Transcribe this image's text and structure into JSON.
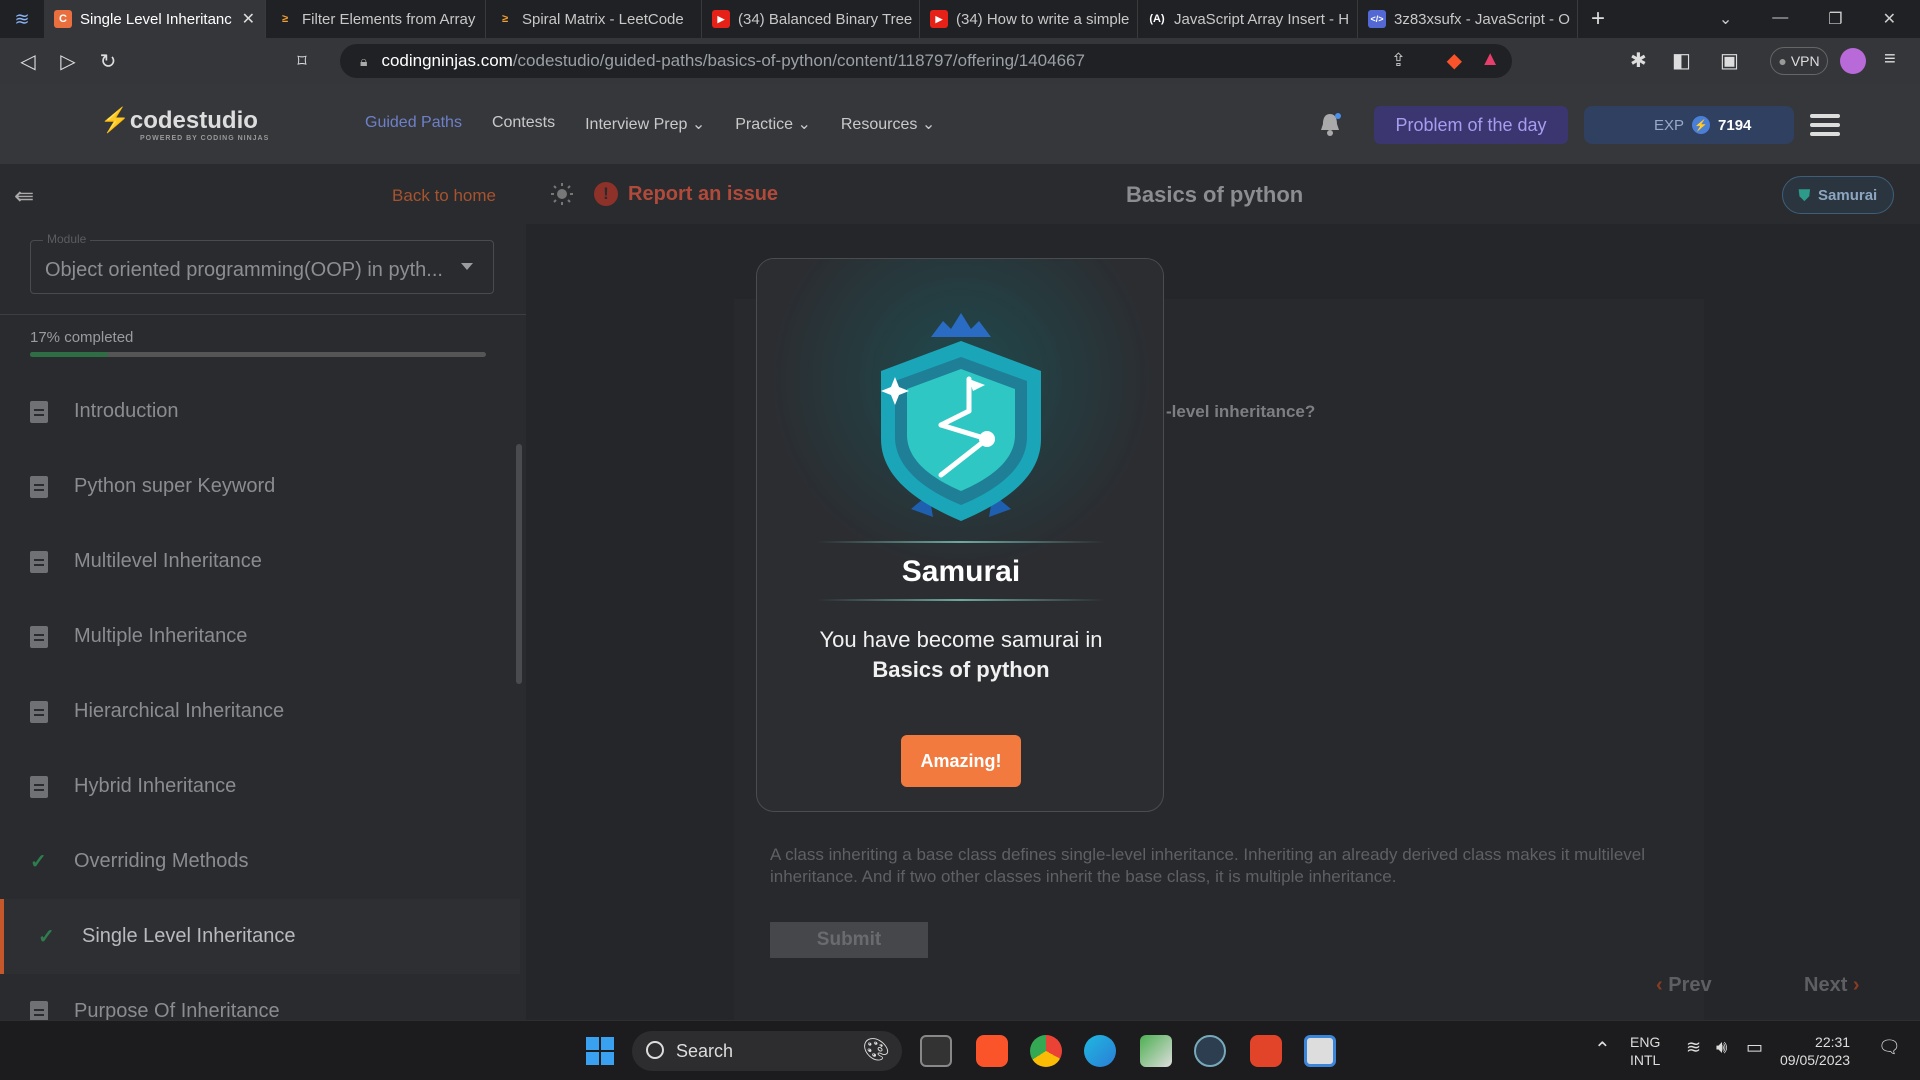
{
  "browser": {
    "tabs": [
      {
        "title": "Single Level Inheritanc",
        "active": true
      },
      {
        "title": "Filter Elements from Array",
        "active": false
      },
      {
        "title": "Spiral Matrix - LeetCode",
        "active": false
      },
      {
        "title": "(34) Balanced Binary Tree",
        "active": false
      },
      {
        "title": "(34) How to write a simple",
        "active": false
      },
      {
        "title": "JavaScript Array Insert - H",
        "active": false
      },
      {
        "title": "3z83xsufx - JavaScript - O",
        "active": false
      }
    ],
    "url_host": "codingninjas.com",
    "url_path": "/codestudio/guided-paths/basics-of-python/content/118797/offering/1404667",
    "vpn_label": "VPN"
  },
  "site": {
    "logo": "codestudio",
    "logo_sub": "POWERED BY CODING NINJAS",
    "nav": [
      {
        "label": "Guided Paths",
        "active": true
      },
      {
        "label": "Contests",
        "active": false
      },
      {
        "label": "Interview Prep",
        "active": false
      },
      {
        "label": "Practice",
        "active": false
      },
      {
        "label": "Resources",
        "active": false
      }
    ],
    "potd_label": "Problem of the day",
    "exp_label": "EXP",
    "exp_value": "7194"
  },
  "sidebar": {
    "back_label": "Back to home",
    "module_label": "Module",
    "module_value": "Object oriented programming(OOP) in pyth...",
    "progress_text": "17% completed",
    "progress_fraction": 0.17,
    "items": [
      {
        "label": "Introduction",
        "state": "doc"
      },
      {
        "label": "Python super Keyword",
        "state": "doc"
      },
      {
        "label": "Multilevel Inheritance",
        "state": "doc"
      },
      {
        "label": "Multiple Inheritance",
        "state": "doc"
      },
      {
        "label": "Hierarchical Inheritance",
        "state": "doc"
      },
      {
        "label": "Hybrid Inheritance",
        "state": "doc"
      },
      {
        "label": "Overriding Methods",
        "state": "done"
      },
      {
        "label": "Single Level Inheritance",
        "state": "active"
      },
      {
        "label": "Purpose Of Inheritance",
        "state": "doc"
      }
    ]
  },
  "main": {
    "report_label": "Report an issue",
    "page_title": "Basics of python",
    "rank_label": "Samurai",
    "question_fragment": "-level inheritance?",
    "explanation": "A class inheriting a base class defines single-level inheritance. Inheriting an already derived class makes it multilevel inheritance. And if two other classes inherit the base class, it is multiple inheritance.",
    "submit_label": "Submit",
    "prev_label": "Prev",
    "next_label": "Next"
  },
  "modal": {
    "title": "Samurai",
    "message_line1": "You have become samurai in",
    "message_line2": "Basics of python",
    "button_label": "Amazing!"
  },
  "taskbar": {
    "search_label": "Search",
    "lang_line1": "ENG",
    "lang_line2": "INTL",
    "time": "22:31",
    "date": "09/05/2023"
  }
}
